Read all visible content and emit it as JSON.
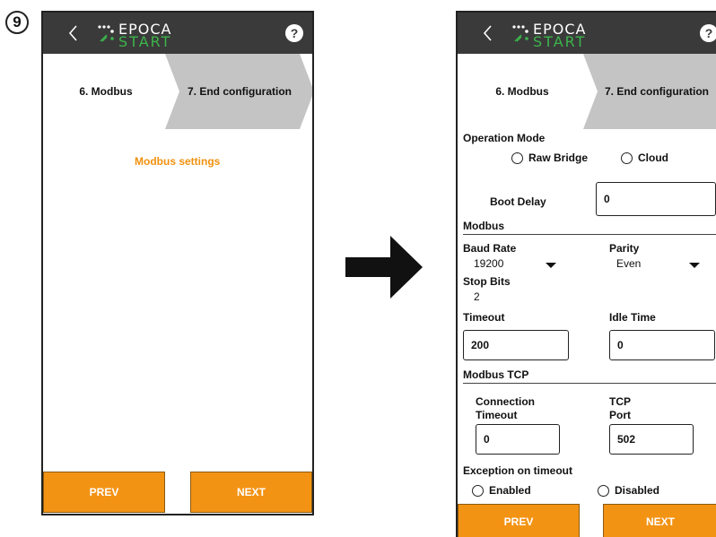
{
  "step_badge": "9",
  "header": {
    "logo_top": "EPOCA",
    "logo_bottom": "START",
    "help": "?"
  },
  "tabs": {
    "current": "6. Modbus",
    "next": "7. End configuration"
  },
  "left_screen": {
    "section_title": "Modbus settings"
  },
  "right_screen": {
    "operation_mode": {
      "label": "Operation Mode",
      "options": [
        "Raw Bridge",
        "Cloud"
      ]
    },
    "boot_delay": {
      "label": "Boot Delay",
      "value": "0"
    },
    "modbus": {
      "heading": "Modbus",
      "baud_rate": {
        "label": "Baud Rate",
        "value": "19200"
      },
      "parity": {
        "label": "Parity",
        "value": "Even"
      },
      "stop_bits": {
        "label": "Stop Bits",
        "value": "2"
      },
      "timeout": {
        "label": "Timeout",
        "value": "200"
      },
      "idle_time": {
        "label": "Idle Time",
        "value": "0"
      }
    },
    "modbus_tcp": {
      "heading": "Modbus TCP",
      "connection_timeout": {
        "label_line1": "Connection",
        "label_line2": "Timeout",
        "value": "0"
      },
      "tcp_port": {
        "label_line1": "TCP",
        "label_line2": "Port",
        "value": "502"
      }
    },
    "exception_on_timeout": {
      "label": "Exception on timeout",
      "options": [
        "Enabled",
        "Disabled"
      ]
    }
  },
  "footer": {
    "prev": "PREV",
    "next": "NEXT"
  },
  "colors": {
    "header_bg": "#3a3a3a",
    "accent_orange": "#f39314",
    "section_title": "#f0910f",
    "tab_grey": "#c4c4c4",
    "logo_green": "#3cb44b"
  }
}
